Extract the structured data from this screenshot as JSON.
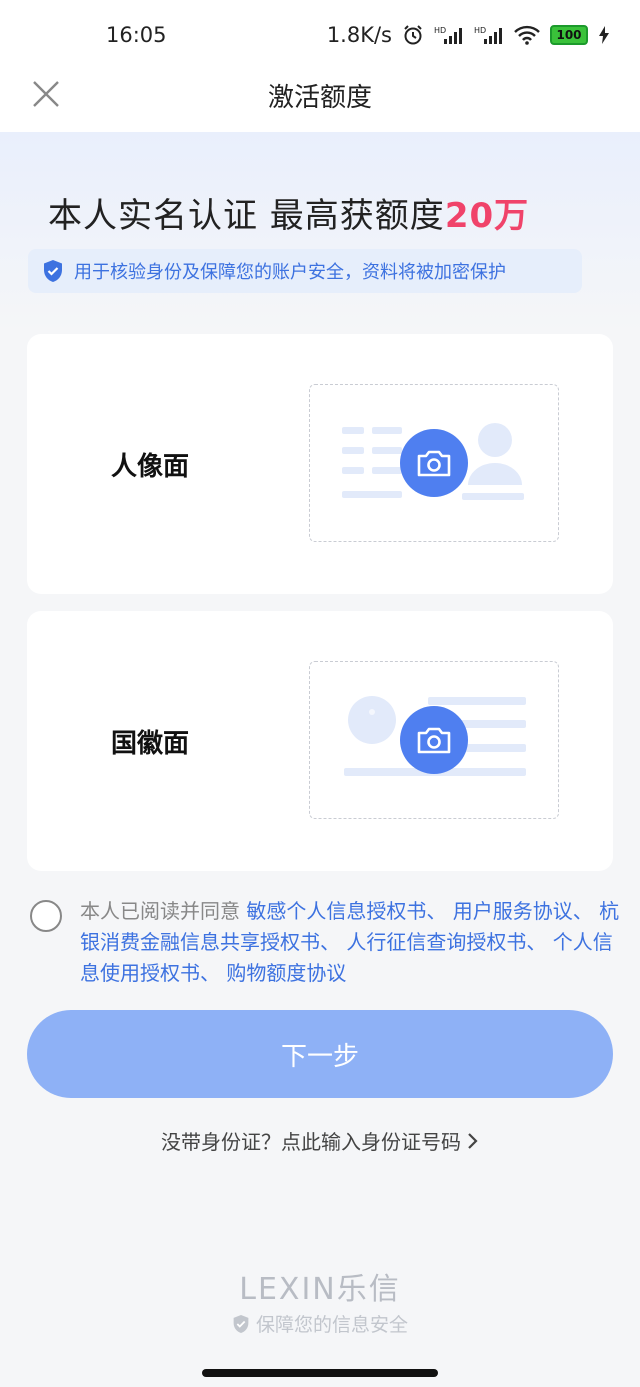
{
  "status_bar": {
    "time": "16:05",
    "network_speed": "1.8K/s",
    "battery_level": "100",
    "icons": [
      "alarm-icon",
      "hd-signal-icon",
      "hd-signal-icon",
      "wifi-icon",
      "battery-icon",
      "charging-icon"
    ]
  },
  "nav": {
    "title": "激活额度",
    "close_icon": "close-icon"
  },
  "headline": {
    "text": "本人实名认证 最高获额度",
    "amount": "20万"
  },
  "notice": {
    "icon": "shield-check-icon",
    "text": "用于核验身份及保障您的账户安全，资料将被加密保护"
  },
  "cards": [
    {
      "label": "人像面",
      "icon": "camera-icon"
    },
    {
      "label": "国徽面",
      "icon": "camera-icon"
    }
  ],
  "agreement": {
    "prefix": "本人已阅读并同意",
    "links": [
      "敏感个人信息授权书、",
      "用户服务协议、",
      "杭银消费金融信息共享授权书、",
      "人行征信查询授权书、",
      "个人信息使用授权书、",
      "购物额度协议"
    ]
  },
  "next_button": {
    "label": "下一步"
  },
  "no_id_link": {
    "text": "没带身份证？点此输入身份证号码"
  },
  "footer": {
    "logo": "LEXIN乐信",
    "security_text": "保障您的信息安全"
  },
  "colors": {
    "accent": "#4f7ff0",
    "link": "#3d72e0",
    "amount": "#f0436a",
    "button": "#8eb1f6"
  }
}
